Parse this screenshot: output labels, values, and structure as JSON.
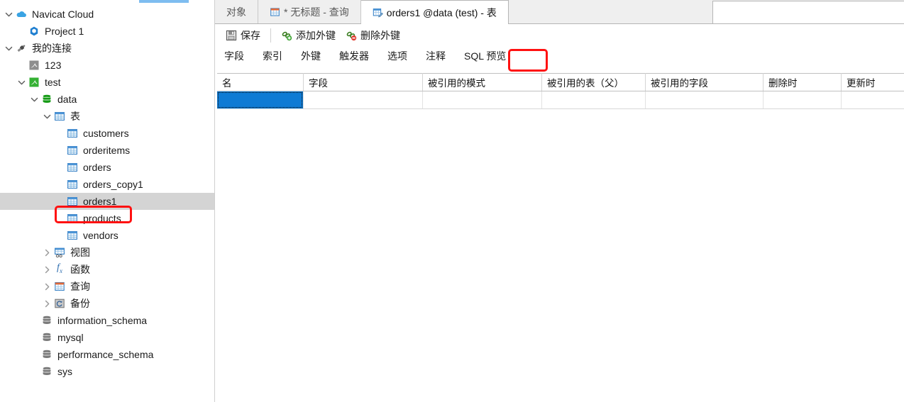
{
  "sidebar": {
    "tree": [
      {
        "id": "navicat-cloud",
        "label": "Navicat Cloud",
        "icon": "cloud-icon",
        "depth": 0,
        "twist": "down"
      },
      {
        "id": "project-1",
        "label": "Project 1",
        "icon": "project-icon",
        "depth": 1,
        "twist": "none"
      },
      {
        "id": "my-connections",
        "label": "我的连接",
        "icon": "connection-icon",
        "depth": 0,
        "twist": "down"
      },
      {
        "id": "conn-123",
        "label": "123",
        "icon": "mysql-gray-icon",
        "depth": 1,
        "twist": "none"
      },
      {
        "id": "conn-test",
        "label": "test",
        "icon": "mysql-green-icon",
        "depth": 1,
        "twist": "down"
      },
      {
        "id": "db-data",
        "label": "data",
        "icon": "database-icon",
        "depth": 2,
        "twist": "down"
      },
      {
        "id": "tables-folder",
        "label": "表",
        "icon": "table-folder-icon",
        "depth": 3,
        "twist": "down"
      },
      {
        "id": "table-customers",
        "label": "customers",
        "icon": "table-icon",
        "depth": 4,
        "twist": "none"
      },
      {
        "id": "table-orderitems",
        "label": "orderitems",
        "icon": "table-icon",
        "depth": 4,
        "twist": "none"
      },
      {
        "id": "table-orders",
        "label": "orders",
        "icon": "table-icon",
        "depth": 4,
        "twist": "none"
      },
      {
        "id": "table-orders-copy1",
        "label": "orders_copy1",
        "icon": "table-icon",
        "depth": 4,
        "twist": "none"
      },
      {
        "id": "table-orders1",
        "label": "orders1",
        "icon": "table-icon",
        "depth": 4,
        "twist": "none",
        "selected": true
      },
      {
        "id": "table-products",
        "label": "products",
        "icon": "table-icon",
        "depth": 4,
        "twist": "none"
      },
      {
        "id": "table-vendors",
        "label": "vendors",
        "icon": "table-icon",
        "depth": 4,
        "twist": "none"
      },
      {
        "id": "views-folder",
        "label": "视图",
        "icon": "view-folder-icon",
        "depth": 3,
        "twist": "right"
      },
      {
        "id": "functions-folder",
        "label": "函数",
        "icon": "function-icon",
        "depth": 3,
        "twist": "right"
      },
      {
        "id": "queries-folder",
        "label": "查询",
        "icon": "query-icon",
        "depth": 3,
        "twist": "right"
      },
      {
        "id": "backups-folder",
        "label": "备份",
        "icon": "backup-icon",
        "depth": 3,
        "twist": "right"
      },
      {
        "id": "db-information-schema",
        "label": "information_schema",
        "icon": "database-gray-icon",
        "depth": 2,
        "twist": "none"
      },
      {
        "id": "db-mysql",
        "label": "mysql",
        "icon": "database-gray-icon",
        "depth": 2,
        "twist": "none"
      },
      {
        "id": "db-performance-schema",
        "label": "performance_schema",
        "icon": "database-gray-icon",
        "depth": 2,
        "twist": "none"
      },
      {
        "id": "db-sys",
        "label": "sys",
        "icon": "database-gray-icon",
        "depth": 2,
        "twist": "none"
      }
    ]
  },
  "tabs": [
    {
      "id": "tab-objects",
      "label": "对象",
      "icon": null,
      "active": false
    },
    {
      "id": "tab-query",
      "label": "* 无标题 - 查询",
      "icon": "query-tab-icon",
      "active": false
    },
    {
      "id": "tab-table-designer",
      "label": "orders1 @data (test) - 表",
      "icon": "table-designer-icon",
      "active": true
    }
  ],
  "toolbar": {
    "save_label": "保存",
    "add_fk_label": "添加外键",
    "delete_fk_label": "删除外键"
  },
  "subtabs": [
    {
      "id": "subtab-fields",
      "label": "字段",
      "active": false
    },
    {
      "id": "subtab-indexes",
      "label": "索引",
      "active": false
    },
    {
      "id": "subtab-foreign-keys",
      "label": "外键",
      "active": true,
      "annotated": true
    },
    {
      "id": "subtab-triggers",
      "label": "触发器",
      "active": false
    },
    {
      "id": "subtab-options",
      "label": "选项",
      "active": false
    },
    {
      "id": "subtab-comment",
      "label": "注释",
      "active": false
    },
    {
      "id": "subtab-sql-preview",
      "label": "SQL 预览",
      "active": false
    }
  ],
  "grid": {
    "columns": [
      {
        "id": "col-name",
        "label": "名",
        "width": 114
      },
      {
        "id": "col-fields",
        "label": "字段",
        "width": 160
      },
      {
        "id": "col-referenced-schema",
        "label": "被引用的模式",
        "width": 160
      },
      {
        "id": "col-referenced-table",
        "label": "被引用的表（父）",
        "width": 138
      },
      {
        "id": "col-referenced-fields",
        "label": "被引用的字段",
        "width": 158
      },
      {
        "id": "col-on-delete",
        "label": "删除时",
        "width": 102
      },
      {
        "id": "col-on-update",
        "label": "更新时",
        "width": 98
      }
    ],
    "rows": [
      {
        "id": "row-1",
        "cells": [
          "",
          "",
          "",
          "",
          "",
          "",
          ""
        ],
        "selected_cell": 0,
        "current": true
      }
    ]
  },
  "colors": {
    "selection_blue": "#0f7bd4",
    "annotation_red": "#ff1111",
    "sidebar_selected_gray": "#d4d4d4",
    "chrome_gray": "#efefef"
  }
}
